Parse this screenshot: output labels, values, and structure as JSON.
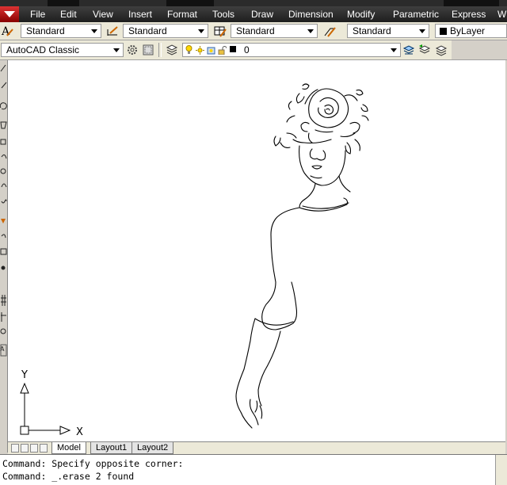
{
  "menu": {
    "items": [
      "File",
      "Edit",
      "View",
      "Insert",
      "Format",
      "Tools",
      "Draw",
      "Dimension",
      "Modify",
      "Parametric",
      "Express",
      "W"
    ]
  },
  "styles_toolbar": {
    "text_style": "Standard",
    "dim_style": "Standard",
    "table_style": "Standard",
    "mleader_style": "Standard",
    "color": "ByLayer"
  },
  "workspace_toolbar": {
    "workspace": "AutoCAD Classic",
    "layer": "0"
  },
  "tabs": {
    "model": "Model",
    "layout1": "Layout1",
    "layout2": "Layout2"
  },
  "ucs": {
    "y_label": "Y",
    "x_label": "X"
  },
  "command_line": {
    "line1": "Command: Specify opposite corner:",
    "line2": "Command: _.erase 2 found"
  },
  "colors": {
    "menubar_bg": "#2a2a2a",
    "app_button": "#b71c1c",
    "canvas_bg": "#ffffff",
    "toolbar_bg": "#ece9d8"
  }
}
